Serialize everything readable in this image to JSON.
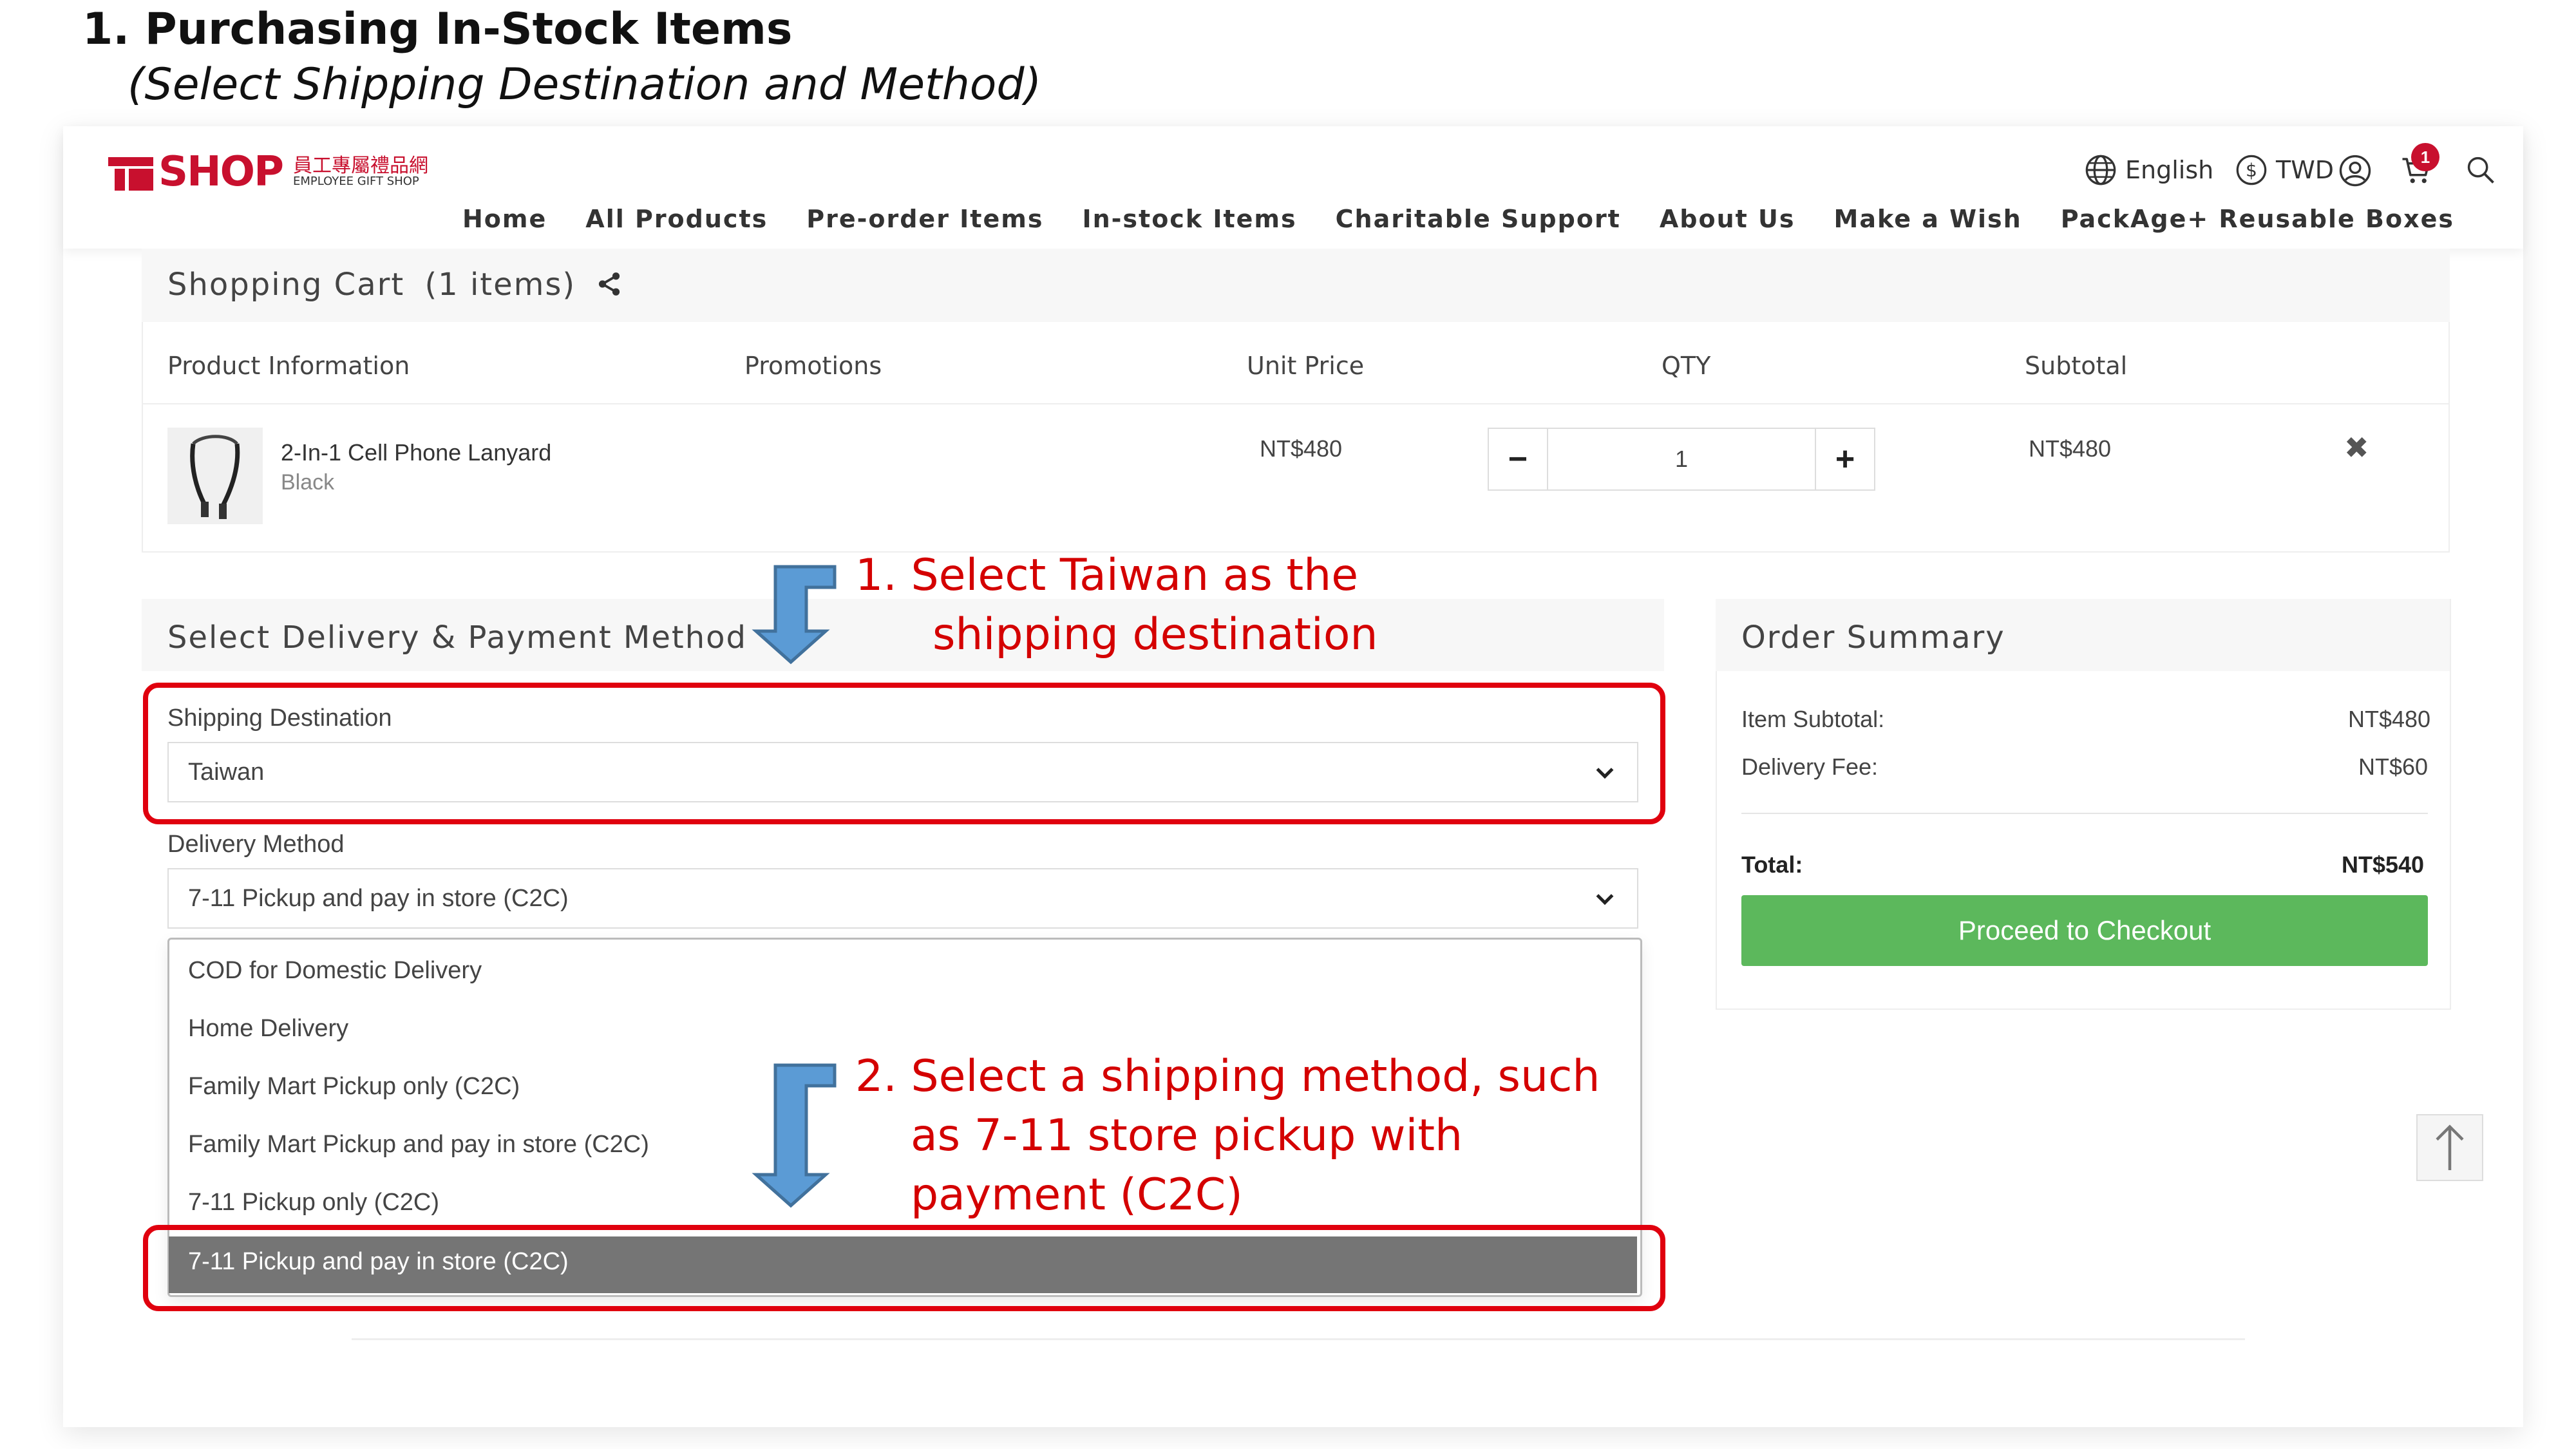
{
  "slide": {
    "title": "1. Purchasing In-Stock Items",
    "subtitle": "(Select Shipping Destination and Method)"
  },
  "header": {
    "logo_text": "SHOP",
    "logo_cn": "員工專屬禮品網",
    "logo_en": "EMPLOYEE GIFT SHOP",
    "language": "English",
    "currency": "TWD",
    "cart_count": "1",
    "nav": [
      "Home",
      "All Products",
      "Pre-order Items",
      "In-stock Items",
      "Charitable Support",
      "About Us",
      "Make a Wish",
      "PackAge+ Reusable Boxes"
    ]
  },
  "cart": {
    "title": "Shopping Cart",
    "count_label": "(1 items)",
    "columns": {
      "product": "Product Information",
      "promotions": "Promotions",
      "unit_price": "Unit Price",
      "qty": "QTY",
      "subtotal": "Subtotal"
    },
    "item": {
      "name": "2-In-1 Cell Phone Lanyard",
      "variant": "Black",
      "unit_price": "NT$480",
      "qty": "1",
      "subtotal": "NT$480",
      "minus": "−",
      "plus": "+",
      "remove": "✖"
    }
  },
  "delivery": {
    "title": "Select Delivery & Payment Method",
    "destination_label": "Shipping Destination",
    "destination_value": "Taiwan",
    "method_label": "Delivery Method",
    "method_value": "7-11 Pickup and pay in store (C2C)",
    "options": [
      "COD for Domestic Delivery",
      "Home Delivery",
      "Family Mart Pickup only (C2C)",
      "Family Mart Pickup and pay in store (C2C)",
      "7-11 Pickup only (C2C)",
      "7-11 Pickup and pay in store (C2C)"
    ]
  },
  "summary": {
    "title": "Order Summary",
    "item_subtotal_label": "Item Subtotal:",
    "item_subtotal": "NT$480",
    "delivery_fee_label": "Delivery Fee:",
    "delivery_fee": "NT$60",
    "total_label": "Total:",
    "total": "NT$540",
    "checkout": "Proceed to Checkout"
  },
  "annotations": {
    "step1_line1": "1.   Select Taiwan as the",
    "step1_line2": "shipping destination",
    "step2_line1": "2. Select a shipping method, such",
    "step2_line2": "as 7-11 store pickup with",
    "step2_line3": "payment (C2C)"
  },
  "colors": {
    "brand": "#c8102e",
    "checkout": "#5cb85c",
    "annotation": "#d40000",
    "arrow": "#5b9bd5",
    "selected_option": "#757575"
  }
}
